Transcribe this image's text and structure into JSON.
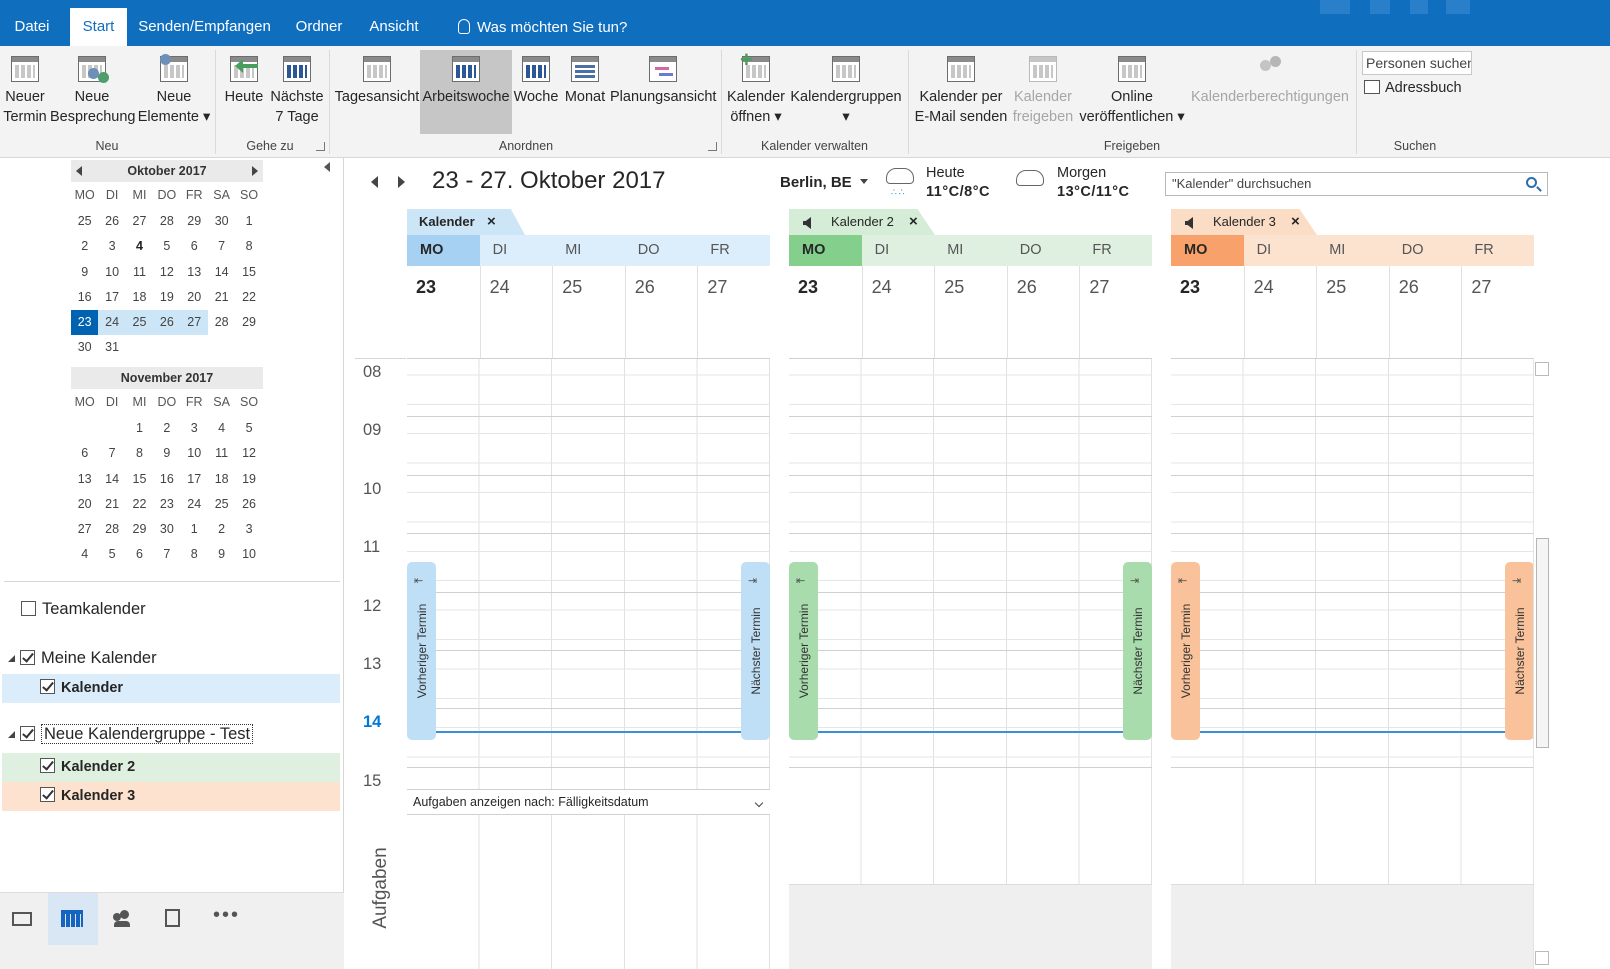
{
  "tabs": [
    {
      "label": "Datei",
      "active": false
    },
    {
      "label": "Start",
      "active": true
    },
    {
      "label": "Senden/Empfangen",
      "active": false
    },
    {
      "label": "Ordner",
      "active": false
    },
    {
      "label": "Ansicht",
      "active": false
    }
  ],
  "tellme": "Was möchten Sie tun?",
  "ribbon": {
    "neuer_termin": [
      "Neuer",
      "Termin"
    ],
    "neue_besprechung": [
      "Neue",
      "Besprechung"
    ],
    "neue_elemente": [
      "Neue",
      "Elemente"
    ],
    "heute": "Heute",
    "naechste7": [
      "Nächste",
      "7 Tage"
    ],
    "tagesansicht": "Tagesansicht",
    "arbeitswoche": "Arbeitswoche",
    "woche": "Woche",
    "monat": "Monat",
    "planungsansicht": "Planungsansicht",
    "kal_oeffnen": [
      "Kalender",
      "öffnen"
    ],
    "kal_gruppen": "Kalendergruppen",
    "kal_email": [
      "Kalender per",
      "E-Mail senden"
    ],
    "kal_freigeben": [
      "Kalender",
      "freigeben"
    ],
    "online": [
      "Online",
      "veröffentlichen"
    ],
    "berechtigungen": "Kalenderberechtigungen",
    "personen_suchen": "Personen suchen",
    "adressbuch": "Adressbuch",
    "groups": {
      "neu": "Neu",
      "gehe_zu": "Gehe zu",
      "anordnen": "Anordnen",
      "verwalten": "Kalender verwalten",
      "freigeben": "Freigeben",
      "suchen": "Suchen"
    }
  },
  "minicals": [
    {
      "title": "Oktober 2017",
      "dow": [
        "MO",
        "DI",
        "MI",
        "DO",
        "FR",
        "SA",
        "SO"
      ],
      "weeks": [
        [
          "25",
          "26",
          "27",
          "28",
          "29",
          "30",
          "1"
        ],
        [
          "2",
          "3",
          "4",
          "5",
          "6",
          "7",
          "8"
        ],
        [
          "9",
          "10",
          "11",
          "12",
          "13",
          "14",
          "15"
        ],
        [
          "16",
          "17",
          "18",
          "19",
          "20",
          "21",
          "22"
        ],
        [
          "23",
          "24",
          "25",
          "26",
          "27",
          "28",
          "29"
        ],
        [
          "30",
          "31",
          "",
          "",
          "",
          "",
          ""
        ]
      ]
    },
    {
      "title": "November 2017",
      "dow": [
        "MO",
        "DI",
        "MI",
        "DO",
        "FR",
        "SA",
        "SO"
      ],
      "weeks": [
        [
          "",
          "",
          "1",
          "2",
          "3",
          "4",
          "5"
        ],
        [
          "6",
          "7",
          "8",
          "9",
          "10",
          "11",
          "12"
        ],
        [
          "13",
          "14",
          "15",
          "16",
          "17",
          "18",
          "19"
        ],
        [
          "20",
          "21",
          "22",
          "23",
          "24",
          "25",
          "26"
        ],
        [
          "27",
          "28",
          "29",
          "30",
          "1",
          "2",
          "3"
        ],
        [
          "4",
          "5",
          "6",
          "7",
          "8",
          "9",
          "10"
        ]
      ]
    }
  ],
  "folders": {
    "teamkalender": "Teamkalender",
    "meine": "Meine Kalender",
    "kalender": "Kalender",
    "gruppe": "Neue Kalendergruppe - Test",
    "kalender2": "Kalender 2",
    "kalender3": "Kalender 3"
  },
  "main": {
    "daterange": "23 - 27. Oktober 2017",
    "city": "Berlin, BE",
    "today_label": "Heute",
    "today_temp": "11°C/8°C",
    "tomorrow_label": "Morgen",
    "tomorrow_temp": "13°C/11°C",
    "search_placeholder": "\"Kalender\" durchsuchen",
    "hours": [
      "08",
      "09",
      "10",
      "11",
      "12",
      "13",
      "14",
      "15"
    ],
    "current_hour": "14",
    "days": [
      "MO",
      "DI",
      "MI",
      "DO",
      "FR"
    ],
    "dates": [
      "23",
      "24",
      "25",
      "26",
      "27"
    ],
    "prev_appt": "Vorheriger Termin",
    "next_appt": "Nächster Termin",
    "tasks_by": "Aufgaben anzeigen nach: Fälligkeitsdatum",
    "tasks_label": "Aufgaben",
    "calendars": [
      {
        "name": "Kalender",
        "tab_color": "#cde6f7",
        "hdr_color": "#dceefb",
        "mo_color": "#a7d1f2",
        "appt_color": "#bfdff7"
      },
      {
        "name": "Kalender 2",
        "tab_color": "#d5ecd6",
        "hdr_color": "#dff0e0",
        "mo_color": "#84cf8b",
        "appt_color": "#a9dcad"
      },
      {
        "name": "Kalender 3",
        "tab_color": "#fbdcc5",
        "hdr_color": "#fce3d0",
        "mo_color": "#f8a16b",
        "appt_color": "#f9c29a"
      }
    ]
  }
}
